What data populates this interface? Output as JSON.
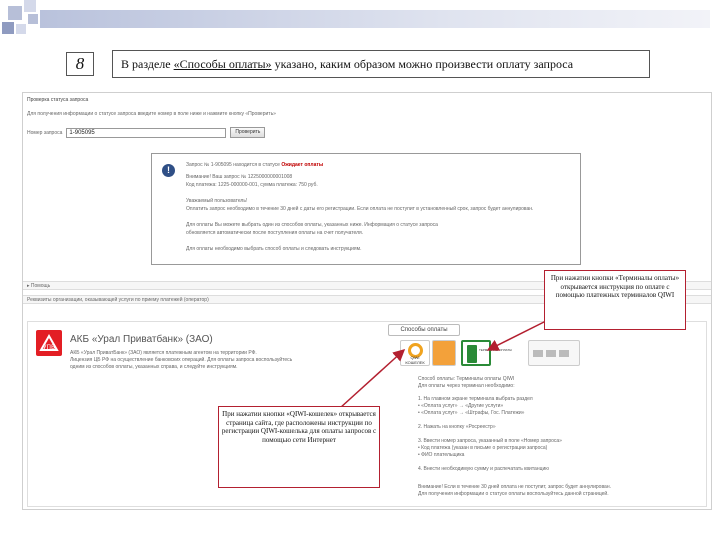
{
  "slide": {
    "number": "8",
    "title_before": "В разделе ",
    "title_link": "«Способы оплаты»",
    "title_after": " указано, каким образом можно произвести оплату запроса"
  },
  "screenshot": {
    "section_header": "Проверка статуса запроса",
    "instruction_line": "Для получения информации о статусе запроса введите номер в поле ниже и нажмите кнопку «Проверить»",
    "number_label": "Номер запроса",
    "number_value": "1-905095",
    "check_button": "Проверить",
    "info_title": "Запрос № 1-905095 находится в статусе",
    "info_status": "Ожидает оплаты",
    "info_lines": [
      "Внимание! Ваш запрос № 1225000000001008",
      "Код платежа: 1225-000000-001, сумма платежа: 750 руб.",
      "",
      "Уважаемый пользователь!",
      "Оплатить запрос необходимо в течение 30 дней с даты его регистрации. Если оплата не поступит в установленный срок, запрос будет аннулирован.",
      "",
      "Для оплаты Вы можете выбрать один из способов оплаты, указанных ниже. Информация о статусе запроса",
      "обновляется автоматически после поступления оплаты на счет получателя.",
      "",
      "Для оплаты необходимо выбрать способ оплаты и следовать инструкциям."
    ],
    "bar_note": "▸ Помощь",
    "bar_payment": "Реквизиты организации, оказывающей услуги по приему платежей (оператор)",
    "bank_name": "АКБ «Урал Приватбанк» (ЗАО)",
    "bank_desc": [
      "АКБ «Урал ПриватБанк» (ЗАО) является платежным агентом на территории РФ.",
      "Лицензия ЦБ РФ на осуществление банковских операций. Для оплаты запроса воспользуйтесь",
      "одним из способов оплаты, указанных справа, и следуйте инструкциям."
    ],
    "pay_methods_label": "Способы оплаты",
    "qiwi_label": "QIWI КОШЕЛЕК",
    "terminal_label": "ТЕРМИНАЛЫ ОПЛАТЫ",
    "instructions": [
      "Способ оплаты: Терминалы оплаты QIWI",
      "Для оплаты через терминал необходимо:",
      "1. На главном экране терминала выбрать раздел",
      "   • «Оплата услуг» → «Другие услуги»",
      "   • «Оплата услуг» → «Штрафы, Гос. Платежи»",
      "2. Нажать на кнопку «Росреестр»",
      "3. Ввести номер запроса, указанный в поле «Номер запроса»",
      "   • Код платежа (указан в письме о регистрации запроса)",
      "   • ФИО плательщика",
      "4. Внести необходимую сумму и распечатать квитанцию",
      "Внимание! Если в течение 30 дней оплата не поступит, запрос будет аннулирован.",
      "Для получения информации о статусе оплаты воспользуйтесь данной страницей."
    ]
  },
  "callouts": {
    "top": "При нажатии кнопки «Терминалы оплаты» открывается инструкция по оплате с помощью платежных терминалов QIWI",
    "bottom": "При нажатии кнопки «QIWI-кошелек» открывается страница сайта, где расположены инструкции по регистрации QIWI-кошелька для оплаты запросов с помощью сети Интернет"
  },
  "colors": {
    "callout_border": "#b32030",
    "terminal_green": "#2a8a37",
    "qiwi_orange": "#f0a31f",
    "bank_red": "#e31e24"
  }
}
